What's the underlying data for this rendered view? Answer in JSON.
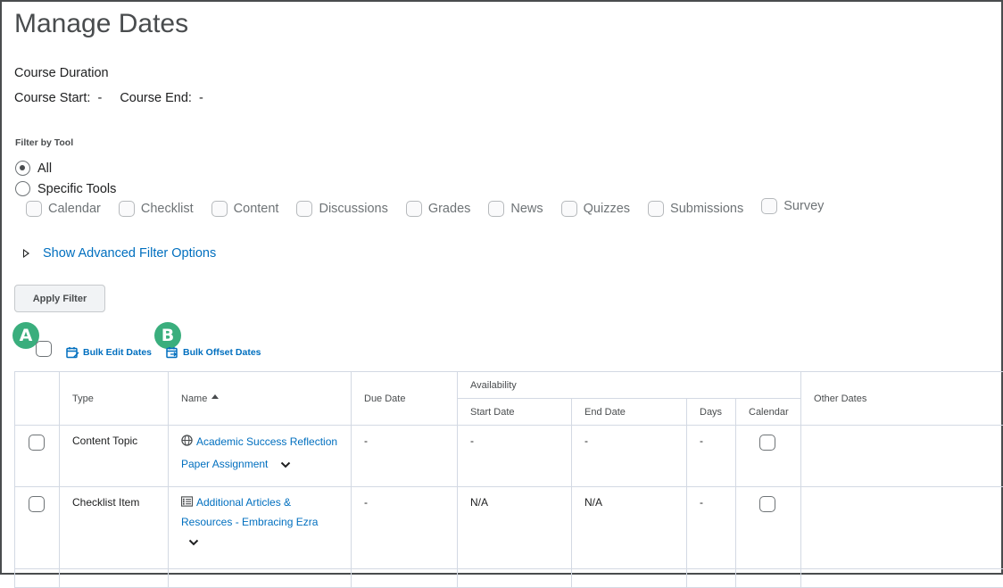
{
  "page": {
    "title": "Manage Dates",
    "course_duration_label": "Course Duration",
    "course_start_label": "Course Start:",
    "course_start_value": "-",
    "course_end_label": "Course End:",
    "course_end_value": "-"
  },
  "filter": {
    "label": "Filter by Tool",
    "options": [
      {
        "label": "All",
        "checked": true
      },
      {
        "label": "Specific Tools",
        "checked": false
      }
    ],
    "tools": [
      "Calendar",
      "Checklist",
      "Content",
      "Discussions",
      "Grades",
      "News",
      "Quizzes",
      "Submissions",
      "Survey"
    ],
    "advanced_label": "Show Advanced Filter Options",
    "apply_label": "Apply Filter"
  },
  "callouts": {
    "a": "A",
    "b": "B"
  },
  "bulk": {
    "edit_label": "Bulk Edit Dates",
    "offset_label": "Bulk Offset Dates"
  },
  "table": {
    "headers": {
      "type": "Type",
      "name": "Name",
      "due": "Due Date",
      "availability": "Availability",
      "start": "Start Date",
      "end": "End Date",
      "days": "Days",
      "calendar": "Calendar",
      "other": "Other Dates"
    },
    "rows": [
      {
        "type": "Content Topic",
        "icon": "globe-icon",
        "name_line1": "Academic Success Reflection",
        "name_line2": "Paper Assignment",
        "due": "-",
        "start": "-",
        "end": "-",
        "days": "-",
        "other": ""
      },
      {
        "type": "Checklist Item",
        "icon": "checklist-icon",
        "name_line1": "Additional Articles &",
        "name_line2": "Resources - Embracing Ezra",
        "due": "-",
        "start": "N/A",
        "end": "N/A",
        "days": "-",
        "other": ""
      }
    ]
  }
}
